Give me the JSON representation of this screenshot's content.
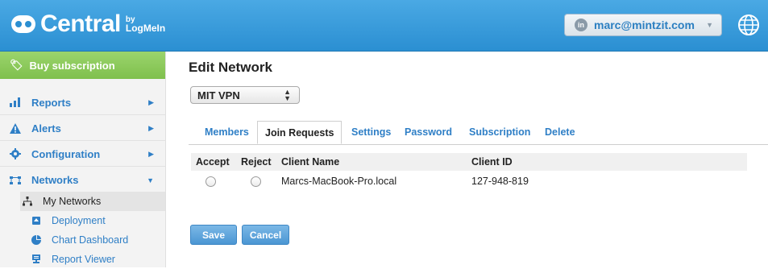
{
  "header": {
    "logo_text": "Central",
    "logo_by_1": "by",
    "logo_by_2": "LogMeIn",
    "user_email": "marc@mintzit.com",
    "user_icon_text": "in"
  },
  "sidebar": {
    "buy_label": "Buy subscription",
    "items": [
      {
        "label": "Reports",
        "icon": "bar-chart-icon"
      },
      {
        "label": "Alerts",
        "icon": "warning-icon"
      },
      {
        "label": "Configuration",
        "icon": "gear-icon"
      },
      {
        "label": "Networks",
        "icon": "network-icon"
      }
    ],
    "subitems": [
      {
        "label": "My Networks",
        "icon": "network-tree-icon"
      },
      {
        "label": "Deployment",
        "icon": "deployment-icon"
      },
      {
        "label": "Chart Dashboard",
        "icon": "pie-chart-icon"
      },
      {
        "label": "Report Viewer",
        "icon": "report-viewer-icon"
      }
    ]
  },
  "main": {
    "title": "Edit Network",
    "network_select": "MIT VPN",
    "tabs": [
      "Members",
      "Join Requests",
      "Settings",
      "Password",
      "Subscription",
      "Delete"
    ],
    "active_tab": "Join Requests",
    "table": {
      "headers": [
        "Accept",
        "Reject",
        "Client Name",
        "Client ID"
      ],
      "rows": [
        {
          "client_name": "Marcs-MacBook-Pro.local",
          "client_id": "127-948-819"
        }
      ]
    },
    "save_label": "Save",
    "cancel_label": "Cancel"
  },
  "colors": {
    "header_blue": "#2b8fd2",
    "link_blue": "#2f7fc6",
    "buy_green": "#7fc04d",
    "button_blue": "#4b96d3"
  }
}
